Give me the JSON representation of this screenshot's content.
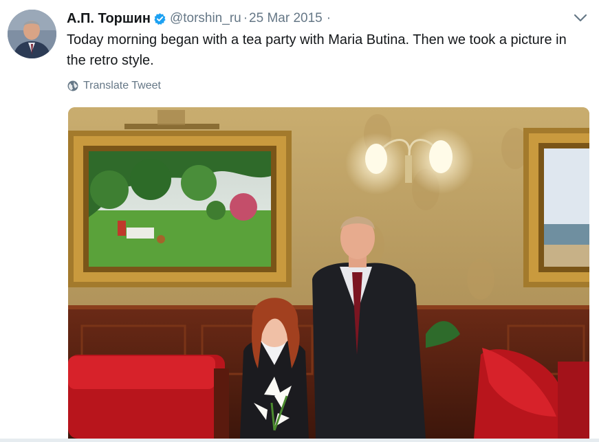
{
  "tweet": {
    "display_name": "А.П. Торшин",
    "verified": true,
    "handle": "@torshin_ru",
    "separator": "·",
    "date": "25 Mar 2015",
    "trailing_separator": "·",
    "text": "Today morning began with a tea party with Maria Butina. Then we took a picture in the retro style.",
    "translate_label": "Translate Tweet"
  },
  "icons": {
    "verified": "verified-badge-icon",
    "caret": "chevron-down-icon",
    "translate": "globe-icon"
  },
  "colors": {
    "text_primary": "#14171a",
    "text_secondary": "#657786",
    "verified_blue": "#1da1f2"
  }
}
